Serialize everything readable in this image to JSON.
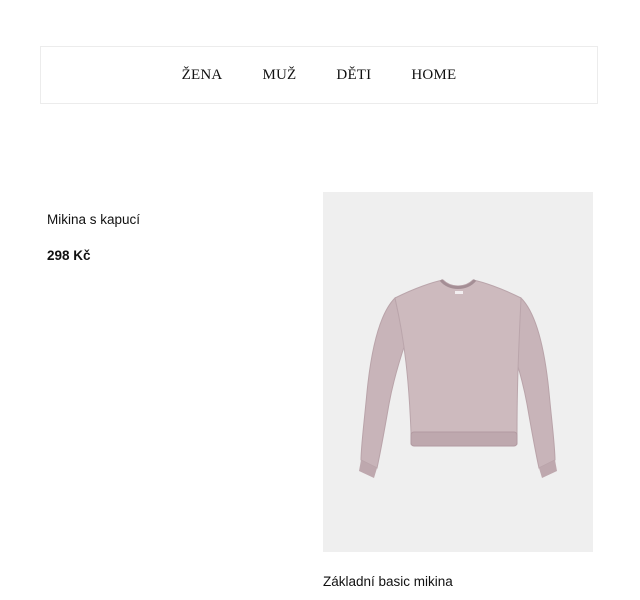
{
  "nav": {
    "items": [
      {
        "label": "ŽENA"
      },
      {
        "label": "MUŽ"
      },
      {
        "label": "DĚTI"
      },
      {
        "label": "HOME"
      }
    ]
  },
  "products": [
    {
      "name": "Mikina s kapucí",
      "price": "298 Kč"
    },
    {
      "name": "Základní basic mikina",
      "image": "mauve-crewneck-sweatshirt"
    }
  ],
  "colors": {
    "sweatshirt": "#cbb8bc",
    "image_background": "#efefef"
  }
}
